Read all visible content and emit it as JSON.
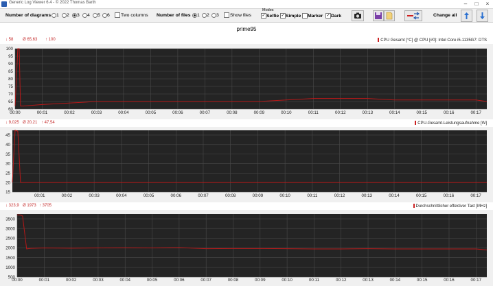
{
  "window": {
    "title": "Generic Log Viewer 6.4 - © 2022 Thomas Barth"
  },
  "toolbar": {
    "num_diagrams_label": "Number of diagrams",
    "diagram_options": [
      "1",
      "2",
      "3",
      "4",
      "5",
      "6"
    ],
    "diagram_selected": "3",
    "two_columns_label": "Two columns",
    "num_files_label": "Number of files",
    "file_options": [
      "1",
      "2",
      "3"
    ],
    "file_selected": "1",
    "show_files_label": "Show files",
    "modes_label": "Modes",
    "modes": [
      {
        "label": "Selfie",
        "checked": true
      },
      {
        "label": "Simple",
        "checked": true
      },
      {
        "label": "Marker",
        "checked": false
      },
      {
        "label": "Dark",
        "checked": true
      }
    ],
    "change_all_label": "Change all",
    "icons": [
      "camera-icon",
      "save-icon",
      "open-file-icon",
      "swap-icon",
      "arrow-up-icon",
      "arrow-down-icon"
    ]
  },
  "page": {
    "title": "prime95"
  },
  "colors": {
    "line": "#b81818",
    "plot_bg": "#242424",
    "grid": "#4a4a4a"
  },
  "panels": [
    {
      "min": "↓ 58",
      "avg": "Ø 65,63",
      "max": "↑ 100",
      "sensor": "CPU Gesamt [°C] @ CPU [#0]: Intel Core i5-1135G7: DTS"
    },
    {
      "min": "↓ 9,025",
      "avg": "Ø 20,21",
      "max": "↑ 47,54",
      "sensor": "CPU-Gesamt-Leistungsaufnahme [W]"
    },
    {
      "min": "↓ 323,9",
      "avg": "Ø 1973",
      "max": "↑ 3705",
      "sensor": "Durchschnittlicher effektiver Takt [MHz]"
    }
  ],
  "chart_data": [
    {
      "type": "line",
      "title": "CPU Gesamt [°C] @ CPU [#0]: Intel Core i5-1135G7: DTS",
      "ylim": [
        60,
        100
      ],
      "yticks": [
        60,
        65,
        70,
        75,
        80,
        85,
        90,
        95,
        100
      ],
      "xticks": [
        "00:00",
        "00:01",
        "00:02",
        "00:03",
        "00:04",
        "00:05",
        "00:06",
        "00:07",
        "00:08",
        "00:09",
        "00:10",
        "00:11",
        "00:12",
        "00:13",
        "00:14",
        "00:15",
        "00:16",
        "00:17"
      ],
      "x_range_min": [
        0,
        17.4
      ],
      "series": [
        {
          "x": [
            0,
            0.1,
            0.15,
            0.2,
            0.3,
            1,
            2,
            3,
            4,
            5,
            6,
            7,
            8,
            9,
            10,
            11,
            12,
            13,
            14,
            15,
            16,
            17,
            17.4
          ],
          "y": [
            62,
            100,
            100,
            62,
            62,
            63,
            64,
            65,
            65,
            65,
            65,
            65,
            65,
            65,
            66,
            67,
            67,
            67,
            66,
            66,
            66,
            66,
            65
          ]
        }
      ]
    },
    {
      "type": "line",
      "title": "CPU-Gesamt-Leistungsaufnahme [W]",
      "ylim": [
        15,
        47.5
      ],
      "yticks": [
        15,
        20,
        25,
        30,
        35,
        40,
        45
      ],
      "xticks": [
        "00:01",
        "00:02",
        "00:03",
        "00:04",
        "00:05",
        "00:06",
        "00:07",
        "00:08",
        "00:09",
        "00:10",
        "00:11",
        "00:12",
        "00:13",
        "00:14",
        "00:15",
        "00:16",
        "00:17"
      ],
      "x_range_min": [
        0,
        17.4
      ],
      "series": [
        {
          "x": [
            0,
            0.1,
            0.2,
            0.3,
            0.5,
            1,
            2,
            3,
            4,
            5,
            6,
            7,
            8,
            9,
            10,
            11,
            12,
            13,
            14,
            15,
            16,
            17,
            17.4
          ],
          "y": [
            20,
            47.5,
            47,
            20,
            20,
            20,
            20,
            20,
            20,
            20,
            20,
            20,
            20,
            20,
            20,
            20,
            20,
            20,
            20,
            20,
            20,
            20,
            20
          ]
        }
      ]
    },
    {
      "type": "line",
      "title": "Durchschnittlicher effektiver Takt [MHz]",
      "ylim": [
        500,
        3750
      ],
      "yticks": [
        500,
        1000,
        1500,
        2000,
        2500,
        3000,
        3500
      ],
      "xticks": [
        "00:00",
        "00:01",
        "00:02",
        "00:03",
        "00:04",
        "00:05",
        "00:06",
        "00:07",
        "00:08",
        "00:09",
        "00:10",
        "00:11",
        "00:12",
        "00:13",
        "00:14",
        "00:15",
        "00:16",
        "00:17"
      ],
      "x_range_min": [
        0,
        17.4
      ],
      "series": [
        {
          "x": [
            0,
            0.1,
            0.2,
            0.35,
            0.5,
            1,
            2,
            3,
            4,
            5,
            6,
            7,
            8,
            9,
            10,
            11,
            12,
            13,
            14,
            15,
            16,
            17,
            17.4
          ],
          "y": [
            3705,
            3700,
            3650,
            1950,
            1980,
            2000,
            1990,
            2000,
            2010,
            2000,
            2020,
            1960,
            1970,
            1970,
            1960,
            1950,
            1950,
            1960,
            1950,
            1950,
            1950,
            1950,
            1900
          ]
        }
      ]
    }
  ]
}
